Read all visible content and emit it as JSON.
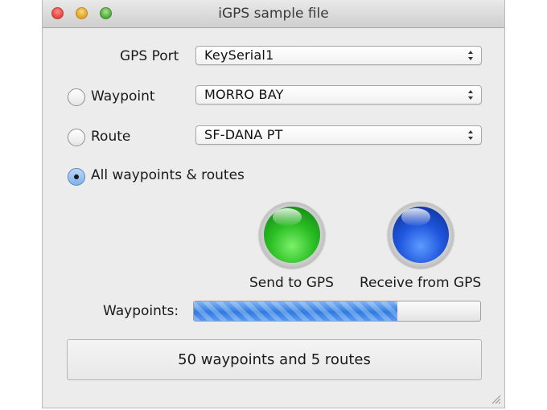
{
  "window": {
    "title": "iGPS sample file"
  },
  "gps_port": {
    "label": "GPS Port",
    "value": "KeySerial1"
  },
  "options": [
    {
      "label": "Waypoint",
      "value": "MORRO BAY",
      "selected": false
    },
    {
      "label": "Route",
      "value": "SF-DANA PT",
      "selected": false
    },
    {
      "label": "All waypoints & routes",
      "selected": true
    }
  ],
  "buttons": {
    "send_label": "Send to GPS",
    "receive_label": "Receive from GPS"
  },
  "progress": {
    "label": "Waypoints:",
    "fraction": 0.71
  },
  "status": {
    "text": "50 waypoints and 5 routes"
  },
  "colors": {
    "send_button": "#2bbf24",
    "receive_button": "#1f56dd",
    "progress_fill": "#2f7be0"
  },
  "icons": [
    "close-icon",
    "minimize-icon",
    "zoom-icon",
    "popup-arrows-icon",
    "resize-grip-icon"
  ]
}
